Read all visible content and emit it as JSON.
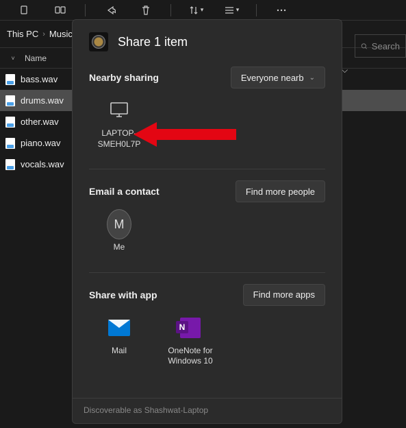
{
  "toolbar": {
    "icons": [
      "copy-icon",
      "clone-icon",
      "share-icon",
      "delete-icon",
      "sort-icon",
      "view-icon",
      "more-icon"
    ]
  },
  "breadcrumb": [
    "This PC",
    "Music"
  ],
  "search": {
    "placeholder": "Search"
  },
  "column_header": {
    "name_label": "Name"
  },
  "files": [
    {
      "name": "bass.wav",
      "selected": false
    },
    {
      "name": "drums.wav",
      "selected": true
    },
    {
      "name": "other.wav",
      "selected": false
    },
    {
      "name": "piano.wav",
      "selected": false
    },
    {
      "name": "vocals.wav",
      "selected": false
    }
  ],
  "share": {
    "title": "Share 1 item",
    "nearby": {
      "title": "Nearby sharing",
      "scope_label": "Everyone nearb",
      "device_name": "LAPTOP-SMEH0L7P"
    },
    "email": {
      "title": "Email a contact",
      "button": "Find more people",
      "contact_initial": "M",
      "contact_name": "Me"
    },
    "apps": {
      "title": "Share with app",
      "button": "Find more apps",
      "items": [
        {
          "label": "Mail"
        },
        {
          "label": "OneNote for Windows 10"
        }
      ]
    },
    "footer": "Discoverable as Shashwat-Laptop"
  },
  "annotation": {
    "arrow_color": "#e30613"
  }
}
